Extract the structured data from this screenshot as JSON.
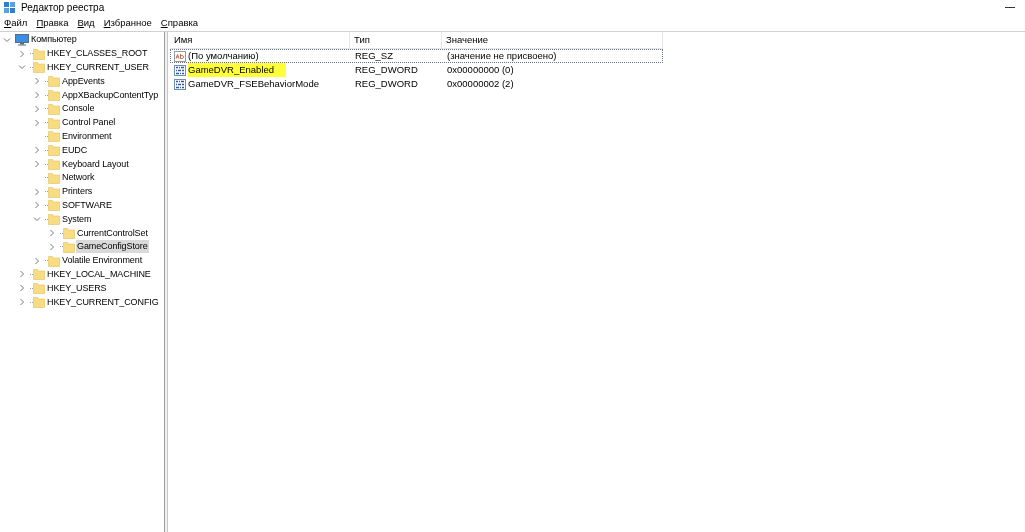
{
  "window": {
    "title": "Редактор реестра"
  },
  "menu": [
    {
      "label": "Файл"
    },
    {
      "label": "Правка"
    },
    {
      "label": "Вид"
    },
    {
      "label": "Избранное"
    },
    {
      "label": "Справка"
    }
  ],
  "tree": [
    {
      "label": "Компьютер",
      "kind": "computer",
      "expandable": true,
      "expanded": true,
      "selected": false,
      "children": [
        {
          "label": "HKEY_CLASSES_ROOT",
          "expandable": true,
          "expanded": false,
          "selected": false
        },
        {
          "label": "HKEY_CURRENT_USER",
          "expandable": true,
          "expanded": true,
          "selected": false,
          "children": [
            {
              "label": "AppEvents",
              "expandable": true,
              "expanded": false,
              "selected": false
            },
            {
              "label": "AppXBackupContentTyp",
              "expandable": true,
              "expanded": false,
              "selected": false
            },
            {
              "label": "Console",
              "expandable": true,
              "expanded": false,
              "selected": false
            },
            {
              "label": "Control Panel",
              "expandable": true,
              "expanded": false,
              "selected": false
            },
            {
              "label": "Environment",
              "expandable": false,
              "expanded": false,
              "selected": false
            },
            {
              "label": "EUDC",
              "expandable": true,
              "expanded": false,
              "selected": false
            },
            {
              "label": "Keyboard Layout",
              "expandable": true,
              "expanded": false,
              "selected": false
            },
            {
              "label": "Network",
              "expandable": false,
              "expanded": false,
              "selected": false
            },
            {
              "label": "Printers",
              "expandable": true,
              "expanded": false,
              "selected": false
            },
            {
              "label": "SOFTWARE",
              "expandable": true,
              "expanded": false,
              "selected": false
            },
            {
              "label": "System",
              "expandable": true,
              "expanded": true,
              "selected": false,
              "children": [
                {
                  "label": "CurrentControlSet",
                  "expandable": true,
                  "expanded": false,
                  "selected": false
                },
                {
                  "label": "GameConfigStore",
                  "expandable": true,
                  "expanded": false,
                  "selected": true
                }
              ]
            },
            {
              "label": "Volatile Environment",
              "expandable": true,
              "expanded": false,
              "selected": false
            }
          ]
        },
        {
          "label": "HKEY_LOCAL_MACHINE",
          "expandable": true,
          "expanded": false,
          "selected": false
        },
        {
          "label": "HKEY_USERS",
          "expandable": true,
          "expanded": false,
          "selected": false
        },
        {
          "label": "HKEY_CURRENT_CONFIG",
          "expandable": true,
          "expanded": false,
          "selected": false
        }
      ]
    }
  ],
  "table": {
    "columns": [
      "Имя",
      "Тип",
      "Значение"
    ],
    "rows": [
      {
        "kind": "string",
        "name": "(По умолчанию)",
        "type": "REG_SZ",
        "value": "(значение не присвоено)",
        "focused": true,
        "highlighted": false
      },
      {
        "kind": "dword",
        "name": "GameDVR_Enabled",
        "type": "REG_DWORD",
        "value": "0x00000000 (0)",
        "focused": false,
        "highlighted": true
      },
      {
        "kind": "dword",
        "name": "GameDVR_FSEBehaviorMode",
        "type": "REG_DWORD",
        "value": "0x00000002 (2)",
        "focused": false,
        "highlighted": false
      }
    ]
  }
}
